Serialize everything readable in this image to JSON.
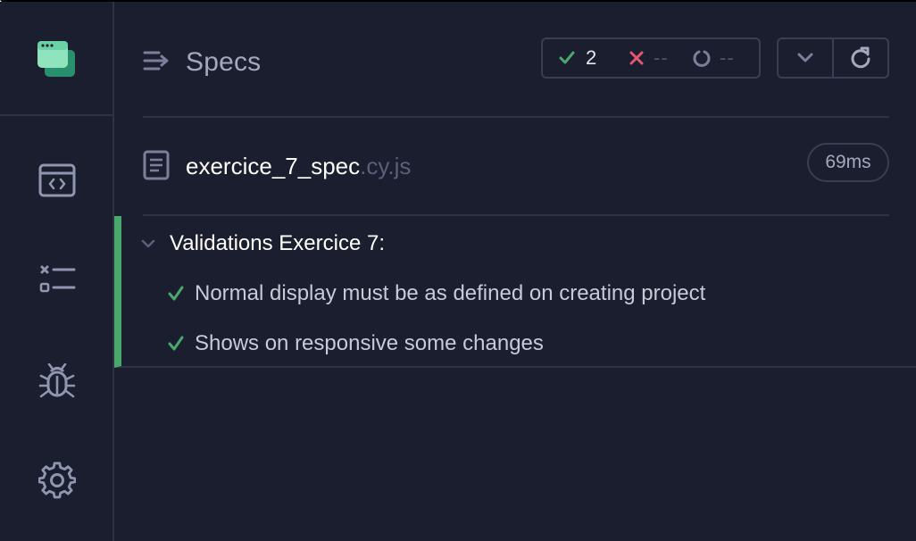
{
  "header": {
    "title": "Specs",
    "stats": {
      "passed": "2",
      "failed": "--",
      "pending": "--"
    }
  },
  "spec": {
    "file_base": "exercice_7_spec",
    "file_ext": ".cy.js",
    "duration": "69ms"
  },
  "suite": {
    "title": "Validations Exercice 7:",
    "tests": [
      {
        "title": "Normal display must be as defined on creating project",
        "state": "passed"
      },
      {
        "title": "Shows on responsive some changes",
        "state": "passed"
      }
    ]
  },
  "sidebar": {
    "items": [
      {
        "icon": "code-browser-icon"
      },
      {
        "icon": "test-list-icon"
      },
      {
        "icon": "bug-icon"
      },
      {
        "icon": "gear-icon"
      }
    ]
  },
  "colors": {
    "background": "#1b1e2e",
    "border": "#2e3247",
    "pass": "#49a86c",
    "fail": "#e45770",
    "logo": "#69d3a7"
  }
}
